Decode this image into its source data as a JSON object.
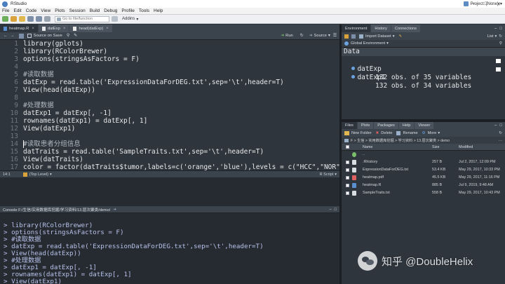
{
  "window": {
    "title": "RStudio",
    "project": "Project: (None)"
  },
  "menu": [
    "File",
    "Edit",
    "Code",
    "View",
    "Plots",
    "Session",
    "Build",
    "Debug",
    "Profile",
    "Tools",
    "Help"
  ],
  "toolbar": {
    "goto_placeholder": "Go to file/function",
    "addins": "Addins"
  },
  "editor": {
    "tabs": [
      "heatmap.R",
      "datExp",
      "head(datExp)"
    ],
    "toolbar": {
      "source_on_save": "Source on Save",
      "run": "Run",
      "source": "Source"
    },
    "status": {
      "position": "14:1",
      "scope": "(Top Level)",
      "filetype": "R Script"
    }
  },
  "code_lines": [
    "library(gplots)",
    "library(RColorBrewer)",
    "options(stringsAsFactors = F)",
    "",
    "#读取数据",
    "datExp = read.table('ExpressionDataForDEG.txt',sep='\\t',header=T)",
    "View(head(datExp))",
    "",
    "#处理数据",
    "datExp1 = datExp[, -1]",
    "rownames(datExp1) = datExp[, 1]",
    "View(datExp1)",
    "",
    "#读取患者分组信息",
    "datTraits = read.table('SampleTraits.txt',sep='\\t',header=T)",
    "View(datTraits)",
    "color = factor(datTraits$tumor,labels=c('orange','blue'),levels = c(\"HCC\",\"NOR\"))",
    "color"
  ],
  "console": {
    "header": "Console  F:/生信/实用数据库挖掘/学习资料/13.层次聚类/demo/",
    "lines": [
      "> library(RColorBrewer)",
      "> options(stringsAsFactors = F)",
      "> #读取数据",
      "> datExp = read.table('ExpressionDataForDEG.txt',sep='\\t',header=T)",
      "> View(head(datExp))",
      "> #处理数据",
      "> datExp1 = datExp[, -1]",
      "> rownames(datExp1) = datExp[, 1]",
      "> View(datExp1)",
      "> "
    ]
  },
  "environment": {
    "tabs": [
      "Environment",
      "History",
      "Connections"
    ],
    "import_label": "Import Dataset",
    "list_label": "List",
    "scope": "Global Environment",
    "section": "Data",
    "rows": [
      {
        "name": "datExp",
        "desc": "132 obs. of 35 variables"
      },
      {
        "name": "datExp1",
        "desc": "132 obs. of 34 variables"
      }
    ]
  },
  "files": {
    "tabs": [
      "Files",
      "Plots",
      "Packages",
      "Help",
      "Viewer"
    ],
    "toolbar": {
      "new_folder": "New Folder",
      "delete": "Delete",
      "rename": "Rename",
      "more": "More"
    },
    "path": "F > 生信 > 实用数据库挖掘 > 学习资料 > 13.层次聚类 > demo",
    "columns": {
      "name": "Name",
      "size": "Size",
      "modified": "Modified"
    },
    "rows": [
      {
        "name": "..",
        "size": "",
        "modified": "",
        "color": "#7bbf6a"
      },
      {
        "name": ".Rhistory",
        "size": "257 B",
        "modified": "Jul 2, 2017, 12:09 PM",
        "color": "#d8dde2"
      },
      {
        "name": "ExpressionDataForDEG.txt",
        "size": "53.4 KB",
        "modified": "May 29, 2017, 10:33 PM",
        "color": "#d8dde2"
      },
      {
        "name": "heatmap.pdf",
        "size": "45.5 KB",
        "modified": "May 29, 2017, 11:16 PM",
        "color": "#e06060"
      },
      {
        "name": "heatmap.R",
        "size": "885 B",
        "modified": "Jul 9, 2019, 9:48 AM",
        "color": "#5a8fd0"
      },
      {
        "name": "SampleTraits.txt",
        "size": "558 B",
        "modified": "May 29, 2017, 10:43 PM",
        "color": "#d8dde2"
      }
    ]
  },
  "watermark": "知乎 @DoubleHelix"
}
